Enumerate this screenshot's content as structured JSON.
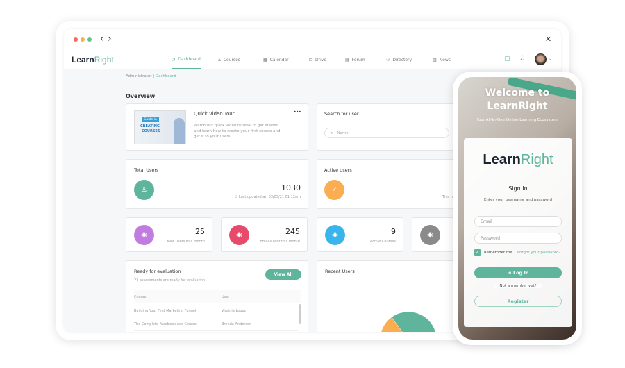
{
  "window": {
    "back": "‹",
    "forward": "›",
    "close": "✕"
  },
  "brand": {
    "learn": "Learn",
    "right": "Right"
  },
  "nav": [
    {
      "label": "Dashboard",
      "icon": "dashboard-icon",
      "glyph": "◔",
      "active": true
    },
    {
      "label": "Courses",
      "icon": "graduation-cap-icon",
      "glyph": "⌂"
    },
    {
      "label": "Calendar",
      "icon": "calendar-icon",
      "glyph": "▦"
    },
    {
      "label": "Drive",
      "icon": "drive-icon",
      "glyph": "⊟"
    },
    {
      "label": "Forum",
      "icon": "forum-icon",
      "glyph": "▤"
    },
    {
      "label": "Directory",
      "icon": "directory-icon",
      "glyph": "⚇"
    },
    {
      "label": "News",
      "icon": "news-icon",
      "glyph": "▥"
    }
  ],
  "breadcrumb": {
    "root": "Administrator",
    "sep": "|",
    "current": "Dashboard"
  },
  "overview": "Overview",
  "video": {
    "title": "Quick Video Tour",
    "desc": "Watch our quick video tutorial to get started and learn how to create your first course and get it to your users.",
    "thumb_line1": "Guide in",
    "thumb_line2": "CREATING",
    "thumb_line3": "COURSES",
    "more": "•••"
  },
  "search": {
    "title": "Search for user",
    "placeholder": "Name"
  },
  "total_users": {
    "title": "Total Users",
    "value": "1030",
    "updated": "Last updated at: 03/05/21 01:12am"
  },
  "active_users": {
    "title": "Active users",
    "note": "This m"
  },
  "stats": [
    {
      "value": "25",
      "label": "New users this month",
      "color": "#c27ce0",
      "icon": "user-add-icon"
    },
    {
      "value": "245",
      "label": "Emails sent this month",
      "color": "#e84a6b",
      "icon": "pen-icon"
    },
    {
      "value": "9",
      "label": "Active Courses",
      "color": "#39b5ec",
      "icon": "course-board-icon"
    },
    {
      "value": "",
      "label": "",
      "color": "#8a8a8a",
      "icon": "window-icon"
    }
  ],
  "evaluation": {
    "title": "Ready for evaluation",
    "subtitle": "23 assessments are ready for evaluation",
    "button": "View All",
    "columns": [
      "Course",
      "User"
    ],
    "rows": [
      [
        "Building Your First Marketing Funnel",
        "Virginia Lopez"
      ],
      [
        "The Complete Facebook Ads Course",
        "Brenda Anderson"
      ]
    ]
  },
  "recent_users": {
    "title": "Recent Users",
    "pie": [
      {
        "value": 45,
        "color": "#5fb49c"
      },
      {
        "value": 15,
        "color": "#c27ce0"
      },
      {
        "value": 40,
        "color": "#fbad52"
      }
    ]
  },
  "login": {
    "welcome": "Welcome to",
    "brand": "LearnRight",
    "tagline": "Your All-In-One Online Learning Ecosystem",
    "logo_learn": "Learn",
    "logo_right": "Right",
    "title": "Sign In",
    "subtitle": "Enter your username and password",
    "email_placeholder": "Email",
    "password_placeholder": "Password",
    "remember": "Remember me",
    "remember_checked": true,
    "forgot": "Forgot your password?",
    "login_button": "Log In",
    "not_member": "Not a member yet?",
    "register": "Register"
  },
  "colors": {
    "accent": "#5fb49c"
  }
}
